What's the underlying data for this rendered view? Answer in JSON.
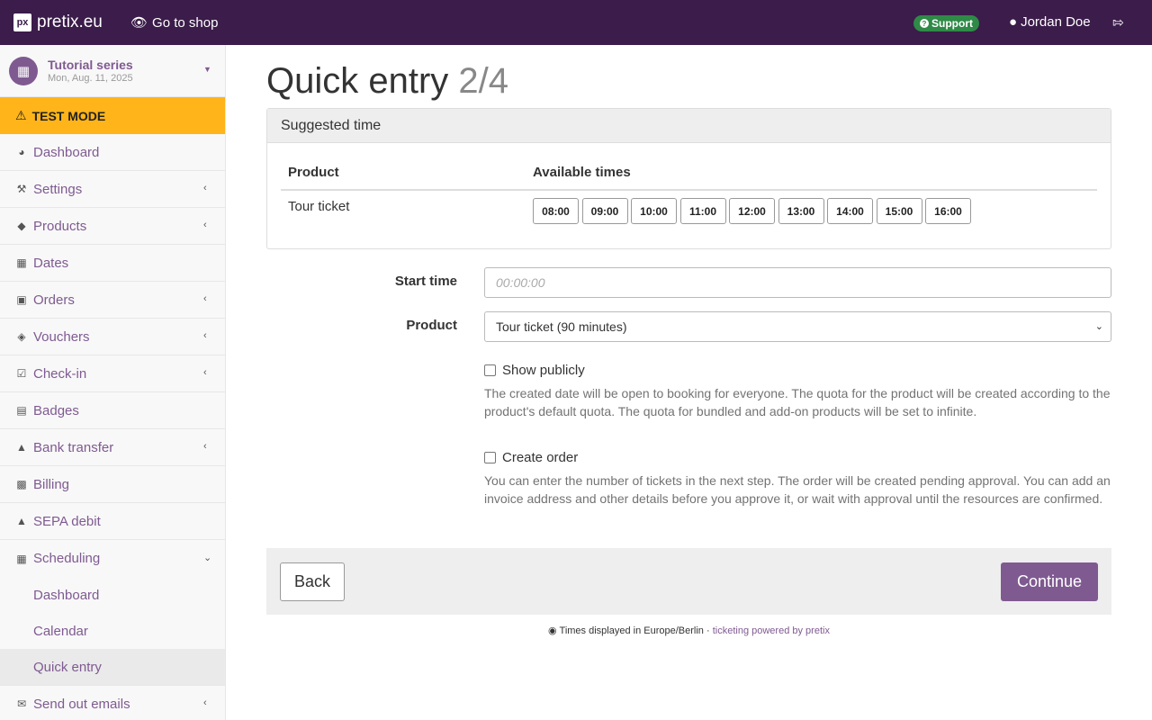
{
  "topbar": {
    "brand": "pretix.eu",
    "go_to_shop": "Go to shop",
    "support": "Support",
    "user": "Jordan Doe"
  },
  "event": {
    "name": "Tutorial series",
    "date": "Mon, Aug. 11, 2025"
  },
  "test_mode": "TEST MODE",
  "nav": {
    "items": [
      {
        "label": "Dashboard",
        "icon": "dashboard-icon"
      },
      {
        "label": "Settings",
        "icon": "wrench-icon"
      },
      {
        "label": "Products",
        "icon": "ticket-icon"
      },
      {
        "label": "Dates",
        "icon": "calendar-icon"
      },
      {
        "label": "Orders",
        "icon": "cart-icon"
      },
      {
        "label": "Vouchers",
        "icon": "tags-icon"
      },
      {
        "label": "Check-in",
        "icon": "check-square-icon"
      },
      {
        "label": "Badges",
        "icon": "id-card-icon"
      },
      {
        "label": "Bank transfer",
        "icon": "bank-icon"
      },
      {
        "label": "Billing",
        "icon": "money-icon"
      },
      {
        "label": "SEPA debit",
        "icon": "bank-icon"
      },
      {
        "label": "Scheduling",
        "icon": "calendar-icon"
      },
      {
        "label": "Send out emails",
        "icon": "envelope-icon"
      }
    ],
    "scheduling_sub": [
      "Dashboard",
      "Calendar",
      "Quick entry"
    ]
  },
  "main": {
    "title": "Quick entry",
    "step": "2/4",
    "panel_title": "Suggested time",
    "col_product": "Product",
    "col_times": "Available times",
    "row_product": "Tour ticket",
    "times": [
      "08:00",
      "09:00",
      "10:00",
      "11:00",
      "12:00",
      "13:00",
      "14:00",
      "15:00",
      "16:00"
    ],
    "start_time_label": "Start time",
    "start_time_placeholder": "00:00:00",
    "product_label": "Product",
    "product_value": "Tour ticket (90 minutes)",
    "show_publicly_label": "Show publicly",
    "show_publicly_help": "The created date will be open to booking for everyone. The quota for the product will be created according to the product's default quota. The quota for bundled and add-on products will be set to infinite.",
    "create_order_label": "Create order",
    "create_order_help": "You can enter the number of tickets in the next step. The order will be created pending approval. You can add an invoice address and other details before you approve it, or wait with approval until the resources are confirmed.",
    "back": "Back",
    "continue": "Continue"
  },
  "footer": {
    "timezone": "Times displayed in Europe/Berlin",
    "separator": "·",
    "powered": "ticketing powered by pretix"
  },
  "colors": {
    "topbar": "#3b1c4a",
    "accent": "#7f5a91",
    "test_mode": "#ffb419",
    "support": "#2e8a46"
  }
}
